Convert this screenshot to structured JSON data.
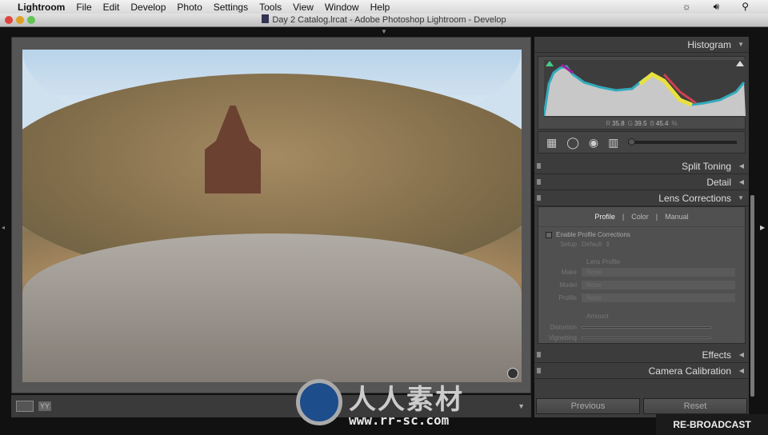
{
  "menubar": {
    "app": "Lightroom",
    "items": [
      "File",
      "Edit",
      "Develop",
      "Photo",
      "Settings",
      "Tools",
      "View",
      "Window",
      "Help"
    ],
    "icons": [
      "brightness-icon",
      "volume-icon",
      "spotlight-search-icon"
    ]
  },
  "window": {
    "title": "Day 2 Catalog.lrcat - Adobe Photoshop Lightroom - Develop"
  },
  "histogram": {
    "label": "Histogram",
    "r_label": "R",
    "r": "35.8",
    "g_label": "G",
    "g": "39.5",
    "b_label": "B",
    "b": "45.4",
    "unit": "%"
  },
  "panels": {
    "split_toning": "Split Toning",
    "detail": "Detail",
    "lens_corrections": "Lens Corrections",
    "effects": "Effects",
    "camera_calibration": "Camera Calibration"
  },
  "lens": {
    "tabs": [
      "Profile",
      "Color",
      "Manual"
    ],
    "active_tab": "Profile",
    "enable_label": "Enable Profile Corrections",
    "enabled": false,
    "setup_label": "Setup",
    "setup_value": "Default",
    "lens_profile_heading": "Lens Profile",
    "make_label": "Make",
    "make_value": "None",
    "model_label": "Model",
    "model_value": "None",
    "profile_label": "Profile",
    "profile_value": "None",
    "amount_heading": "Amount",
    "distortion_label": "Distortion",
    "vignetting_label": "Vignetting"
  },
  "buttons": {
    "previous": "Previous",
    "reset": "Reset"
  },
  "toolbar": {
    "compare_label": "YY"
  },
  "watermark": {
    "chinese": "人人素材",
    "url": "www.rr-sc.com"
  },
  "badge": "RE-BROADCAST"
}
